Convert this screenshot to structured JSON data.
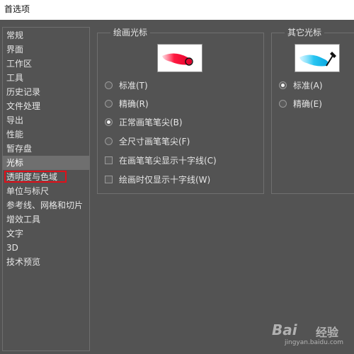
{
  "window": {
    "title": "首选项"
  },
  "sidebar": {
    "items": [
      {
        "label": "常规"
      },
      {
        "label": "界面"
      },
      {
        "label": "工作区"
      },
      {
        "label": "工具"
      },
      {
        "label": "历史记录"
      },
      {
        "label": "文件处理"
      },
      {
        "label": "导出"
      },
      {
        "label": "性能"
      },
      {
        "label": "暂存盘"
      },
      {
        "label": "光标"
      },
      {
        "label": "透明度与色域"
      },
      {
        "label": "单位与标尺"
      },
      {
        "label": "参考线、网格和切片"
      },
      {
        "label": "增效工具"
      },
      {
        "label": "文字"
      },
      {
        "label": "3D"
      },
      {
        "label": "技术预览"
      }
    ],
    "selected": "光标",
    "highlighted": "透明度与色域"
  },
  "painting_cursors": {
    "title": "绘画光标",
    "options": [
      {
        "label": "标准(T)",
        "checked": false
      },
      {
        "label": "精确(R)",
        "checked": false
      },
      {
        "label": "正常画笔笔尖(B)",
        "checked": true
      },
      {
        "label": "全尺寸画笔笔尖(F)",
        "checked": false
      }
    ],
    "checkboxes": [
      {
        "label": "在画笔笔尖显示十字线(C)",
        "checked": false
      },
      {
        "label": "绘画时仅显示十字线(W)",
        "checked": false
      }
    ],
    "preview_icon": "red-brush-stroke-icon"
  },
  "other_cursors": {
    "title": "其它光标",
    "options": [
      {
        "label": "标准(A)",
        "checked": true
      },
      {
        "label": "精确(E)",
        "checked": false
      }
    ],
    "preview_icon": "eyedropper-icon"
  },
  "watermark": {
    "brand": "Bai",
    "word": "经验",
    "url": "jingyan.baidu.com"
  },
  "colors": {
    "background": "#535353",
    "highlight_border": "#e0101a",
    "selected_item": "#6f6f6f"
  }
}
